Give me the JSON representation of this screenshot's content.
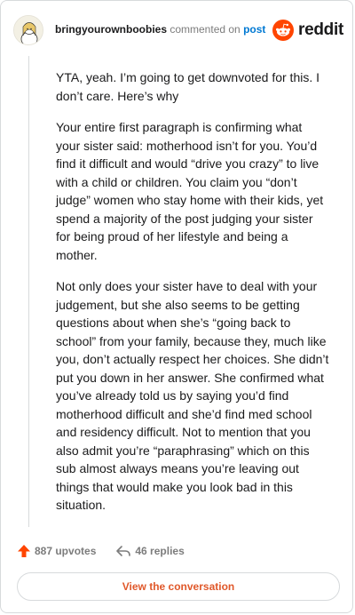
{
  "header": {
    "username": "bringyourownboobies",
    "action_text": "commented on",
    "post_link": "post",
    "brand_name": "reddit",
    "brand_color": "#ff4500",
    "link_color": "#0079d3"
  },
  "comment": {
    "paragraphs": [
      "YTA, yeah. I’m going to get downvoted for this. I don’t care. Here’s why",
      "Your entire first paragraph is confirming what your sister said: motherhood isn’t for you. You’d find it difficult and would “drive you crazy” to live with a child or children. You claim you “don’t judge” women who stay home with their kids, yet spend a majority of the post judging your sister for being proud of her lifestyle and being a mother.",
      "Not only does your sister have to deal with your judgement, but she also seems to be getting questions about when she’s “going back to school” from your family, because they, much like you, don’t actually respect her choices. She didn’t put you down in her answer. She confirmed what you’ve already told us by saying you’d find motherhood difficult and she’d find med school and residency difficult. Not to mention that you also admit you’re “paraphrasing” which on this sub almost always means you’re leaving out things that would make you look bad in this situation."
    ]
  },
  "actions": {
    "upvotes": "887 upvotes",
    "upvote_icon": "upvote-arrow-icon",
    "upvote_color": "#ff4500",
    "replies": "46 replies",
    "reply_icon": "reply-arrow-icon"
  },
  "footer": {
    "view_conversation": "View the conversation",
    "button_color": "#e0582a"
  }
}
